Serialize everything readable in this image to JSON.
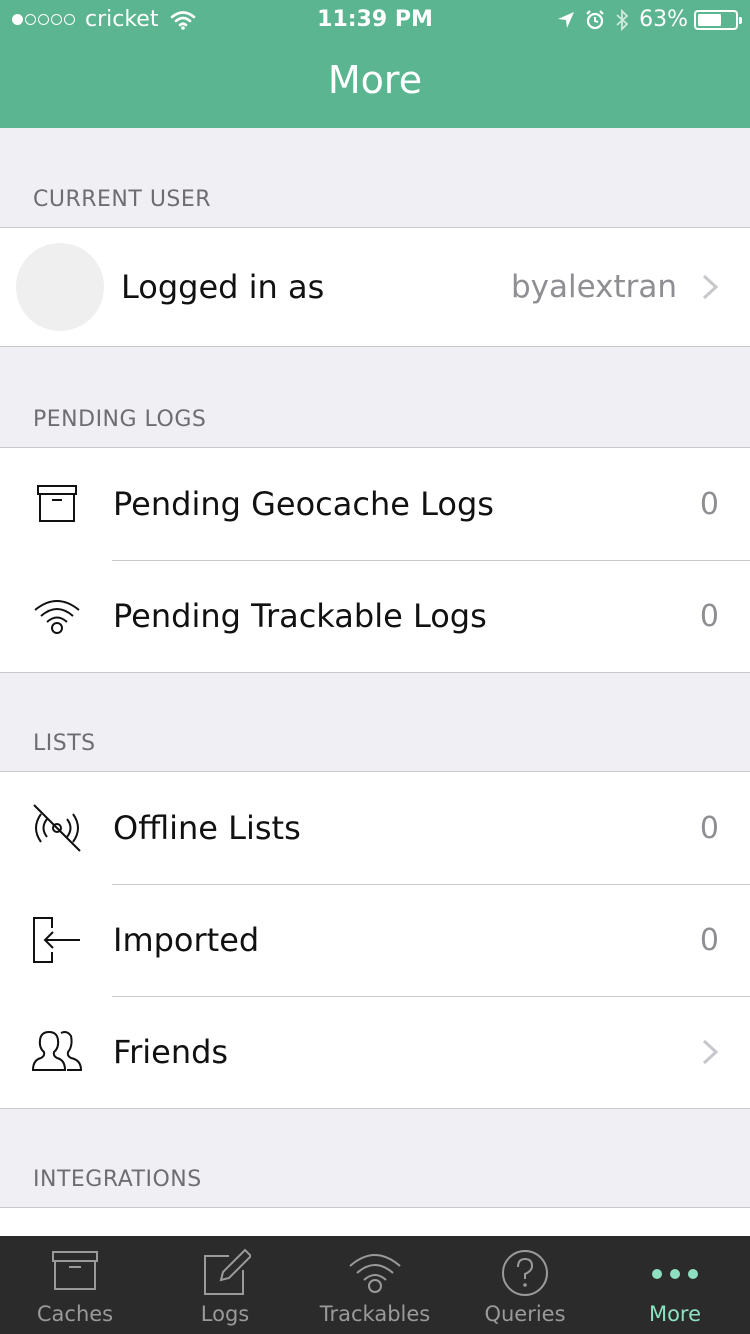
{
  "status_bar": {
    "carrier": "cricket",
    "time": "11:39 PM",
    "battery": "63%",
    "battery_level": 0.63
  },
  "nav": {
    "title": "More"
  },
  "sections": {
    "current_user": {
      "header": "CURRENT USER",
      "label": "Logged in as",
      "value": "byalextran"
    },
    "pending_logs": {
      "header": "PENDING LOGS",
      "items": [
        {
          "label": "Pending Geocache Logs",
          "value": "0",
          "icon": "geocache-box-icon"
        },
        {
          "label": "Pending Trackable Logs",
          "value": "0",
          "icon": "trackable-signal-icon"
        }
      ]
    },
    "lists": {
      "header": "LISTS",
      "items": [
        {
          "label": "Offline Lists",
          "value": "0",
          "icon": "offline-icon"
        },
        {
          "label": "Imported",
          "value": "0",
          "icon": "import-icon"
        },
        {
          "label": "Friends",
          "value": "",
          "icon": "friends-icon"
        }
      ]
    },
    "integrations": {
      "header": "INTEGRATIONS"
    }
  },
  "tabbar": {
    "tabs": [
      {
        "label": "Caches",
        "icon": "box-icon"
      },
      {
        "label": "Logs",
        "icon": "pencil-icon"
      },
      {
        "label": "Trackables",
        "icon": "trackable-icon"
      },
      {
        "label": "Queries",
        "icon": "question-icon"
      },
      {
        "label": "More",
        "icon": "more-dots-icon"
      }
    ],
    "active": "More"
  },
  "colors": {
    "accent": "#5cb591",
    "tab_active": "#8ee0c1",
    "tabbar_bg": "#2b2b2b"
  }
}
